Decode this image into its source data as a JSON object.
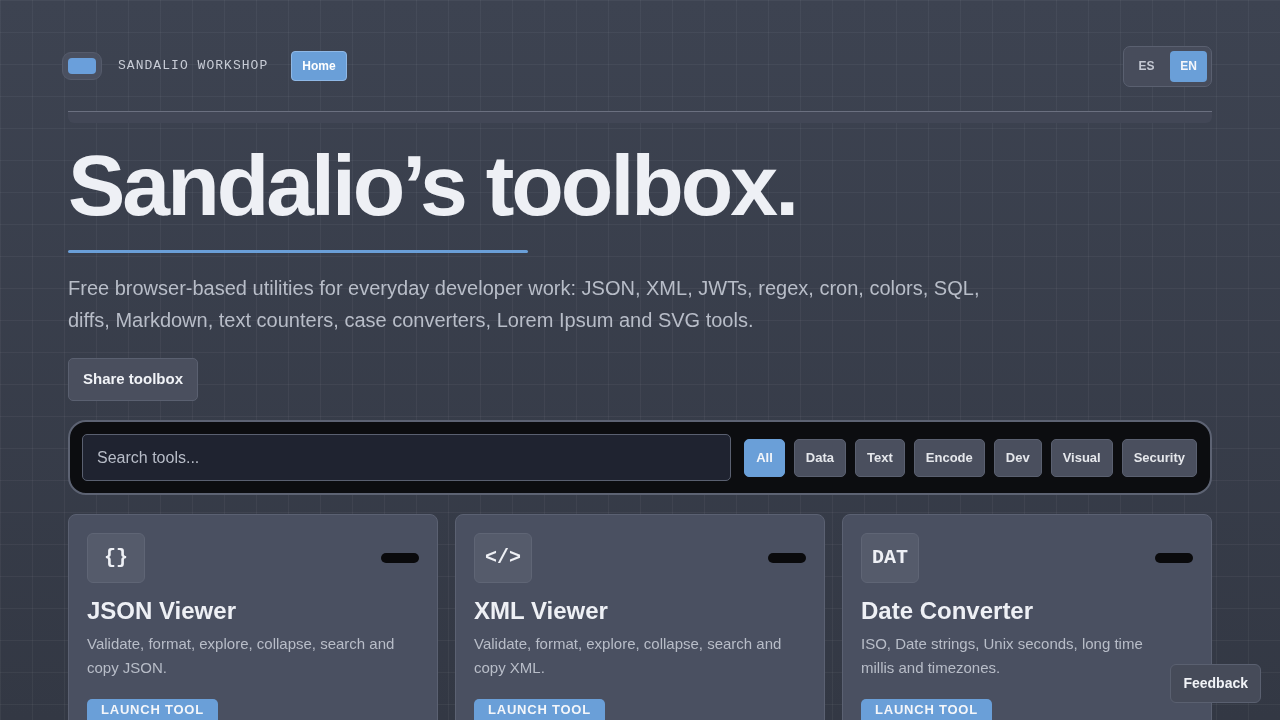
{
  "header": {
    "brand": "SANDALIO WORKSHOP",
    "nav": [
      {
        "label": "Home",
        "selected": true
      }
    ],
    "languages": [
      {
        "label": "ES",
        "selected": false
      },
      {
        "label": "EN",
        "selected": true
      }
    ]
  },
  "hero": {
    "title": "Sandalio’s toolbox.",
    "description": "Free browser-based utilities for everyday developer work: JSON, XML, JWTs, regex, cron, colors, SQL, diffs, Markdown, text counters, case converters, Lorem Ipsum and SVG tools.",
    "share_button": "Share toolbox"
  },
  "search": {
    "placeholder": "Search tools..."
  },
  "filters": [
    {
      "label": "All",
      "selected": true
    },
    {
      "label": "Data",
      "selected": false
    },
    {
      "label": "Text",
      "selected": false
    },
    {
      "label": "Encode",
      "selected": false
    },
    {
      "label": "Dev",
      "selected": false
    },
    {
      "label": "Visual",
      "selected": false
    },
    {
      "label": "Security",
      "selected": false
    }
  ],
  "tools": [
    {
      "glyph": "{}",
      "title": "JSON Viewer",
      "description": "Validate, format, explore, collapse, search and copy JSON.",
      "button": "LAUNCH TOOL"
    },
    {
      "glyph": "</>",
      "title": "XML Viewer",
      "description": "Validate, format, explore, collapse, search and copy XML.",
      "button": "LAUNCH TOOL"
    },
    {
      "glyph": "DAT",
      "title": "Date Converter",
      "description": "ISO, Date strings, Unix seconds, long time millis and timezones.",
      "button": "LAUNCH TOOL"
    }
  ],
  "feedback_button": "Feedback"
}
